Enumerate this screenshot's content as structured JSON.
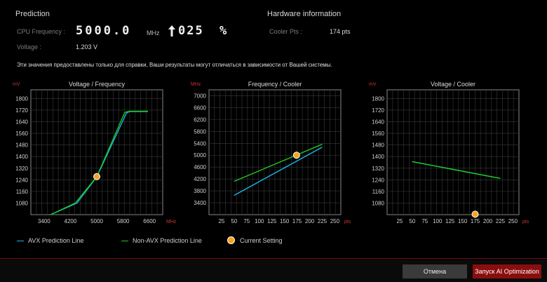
{
  "prediction": {
    "title": "Prediction",
    "cpu_freq_label": "CPU Frequency :",
    "cpu_freq_value": "5000.0",
    "cpu_freq_unit": "MHz",
    "percent_value": "025",
    "percent_unit": "%",
    "voltage_label": "Voltage :",
    "voltage_value": "1.203 V"
  },
  "hardware": {
    "title": "Hardware information",
    "cooler_label": "Cooler Pts :",
    "cooler_value": "174 pts"
  },
  "note": "Эти значения предоставлены только для справки, Ваши результаты могут отличаться в зависимости от Вашей системы.",
  "colors": {
    "avx": "#1ab4e6",
    "non_avx": "#22c322",
    "current": "#f5a31a",
    "accent_red": "#c62828"
  },
  "chart_data": [
    {
      "type": "line",
      "title": "Voltage / Frequency",
      "y_unit": "mV",
      "x_unit": "MHz",
      "yticks": [
        1080,
        1160,
        1240,
        1320,
        1400,
        1480,
        1560,
        1640,
        1720,
        1800
      ],
      "xticks": [
        3400,
        4200,
        5000,
        5800,
        6600
      ],
      "xlim": [
        3000,
        7000
      ],
      "ylim": [
        1000,
        1860
      ],
      "series": [
        {
          "name": "AVX Prediction Line",
          "color": "#1ab4e6",
          "x": [
            3600,
            4400,
            5000,
            5900,
            6000,
            6550
          ],
          "y": [
            1000,
            1080,
            1260,
            1700,
            1710,
            1710
          ]
        },
        {
          "name": "Non-AVX Prediction Line",
          "color": "#22c322",
          "x": [
            3600,
            4350,
            5000,
            5850,
            6000,
            6550
          ],
          "y": [
            1000,
            1080,
            1262,
            1705,
            1712,
            1712
          ]
        }
      ],
      "current": {
        "x": 5000,
        "y": 1262
      }
    },
    {
      "type": "line",
      "title": "Frequency / Cooler",
      "y_unit": "MHz",
      "x_unit": "pts",
      "yticks": [
        3400,
        3800,
        4200,
        4600,
        5000,
        5400,
        5800,
        6200,
        6600,
        7000
      ],
      "xticks": [
        25,
        50,
        75,
        100,
        125,
        150,
        175,
        200,
        225,
        250
      ],
      "xlim": [
        0,
        262
      ],
      "ylim": [
        3000,
        7200
      ],
      "series": [
        {
          "name": "AVX Prediction Line",
          "color": "#1ab4e6",
          "x": [
            50,
            225
          ],
          "y": [
            3650,
            5270
          ]
        },
        {
          "name": "Non-AVX Prediction Line",
          "color": "#22c322",
          "x": [
            50,
            225
          ],
          "y": [
            4120,
            5370
          ]
        }
      ],
      "current": {
        "x": 174,
        "y": 5000
      }
    },
    {
      "type": "line",
      "title": "Voltage / Cooler",
      "y_unit": "mV",
      "x_unit": "pts",
      "yticks": [
        1080,
        1160,
        1240,
        1320,
        1400,
        1480,
        1560,
        1640,
        1720,
        1800
      ],
      "xticks": [
        25,
        50,
        75,
        100,
        125,
        150,
        175,
        200,
        225,
        250
      ],
      "xlim": [
        0,
        262
      ],
      "ylim": [
        1000,
        1860
      ],
      "series": [
        {
          "name": "AVX Prediction Line",
          "color": "#1ab4e6",
          "x": [
            50,
            225
          ],
          "y": [
            1365,
            1250
          ]
        },
        {
          "name": "Non-AVX Prediction Line",
          "color": "#22c322",
          "x": [
            50,
            225
          ],
          "y": [
            1365,
            1250
          ]
        }
      ],
      "current": {
        "x": 175,
        "y": 1003
      }
    }
  ],
  "legend": {
    "avx": "AVX Prediction Line",
    "non_avx": "Non-AVX Prediction Line",
    "current": "Current Setting"
  },
  "buttons": {
    "cancel": "Отмена",
    "start": "Запуск AI Optimization"
  }
}
